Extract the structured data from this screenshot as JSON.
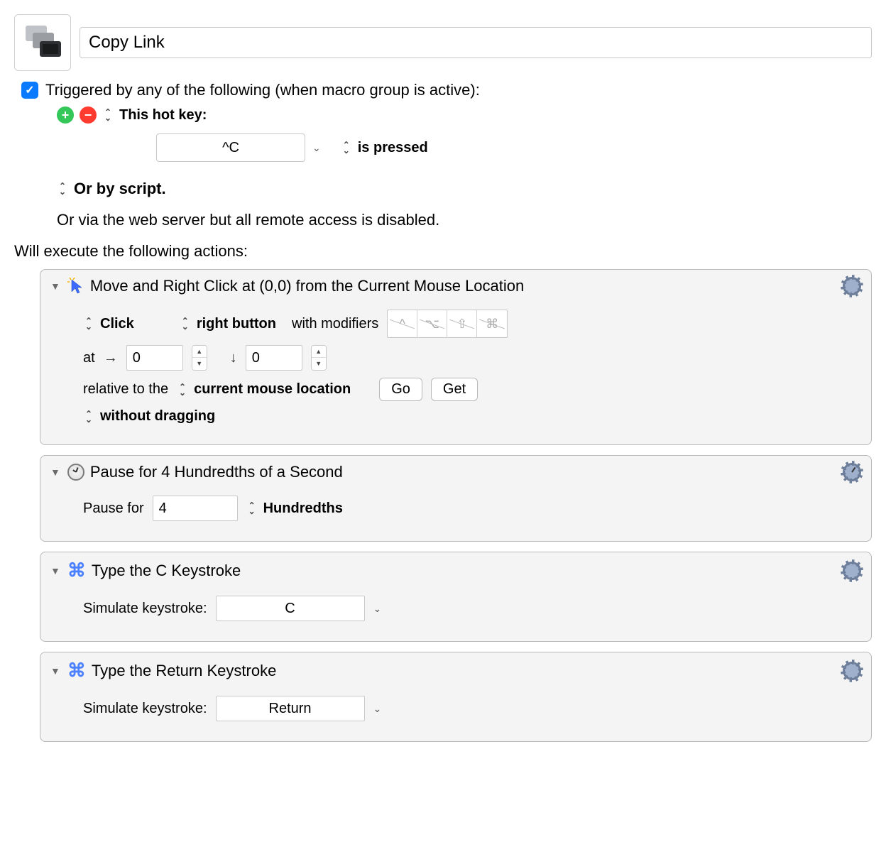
{
  "macro": {
    "name": "Copy Link"
  },
  "triggered_label": "Triggered by any of the following (when macro group is active):",
  "triggers": {
    "hotkey_label": "This hot key:",
    "hotkey_value": "^C",
    "hotkey_action": "is pressed",
    "script_label": "Or by script.",
    "webserver_label": "Or via the web server but all remote access is disabled."
  },
  "exec_label": "Will execute the following actions:",
  "actions": [
    {
      "title": "Move and Right Click at (0,0) from the Current Mouse Location",
      "click_action": "Click",
      "button": "right button",
      "modifiers_label": "with modifiers",
      "mods": [
        "^",
        "⌥",
        "⇧",
        "⌘"
      ],
      "at_label": "at",
      "x_arrow": "→",
      "x": "0",
      "y_arrow": "↓",
      "y": "0",
      "relative_label": "relative to the",
      "relative_value": "current mouse location",
      "go_label": "Go",
      "get_label": "Get",
      "drag_value": "without dragging"
    },
    {
      "title": "Pause for 4 Hundredths of a Second",
      "pause_label": "Pause for",
      "pause_value": "4",
      "unit": "Hundredths"
    },
    {
      "title": "Type the C Keystroke",
      "sim_label": "Simulate keystroke:",
      "key": "C"
    },
    {
      "title": "Type the Return Keystroke",
      "sim_label": "Simulate keystroke:",
      "key": "Return"
    }
  ]
}
